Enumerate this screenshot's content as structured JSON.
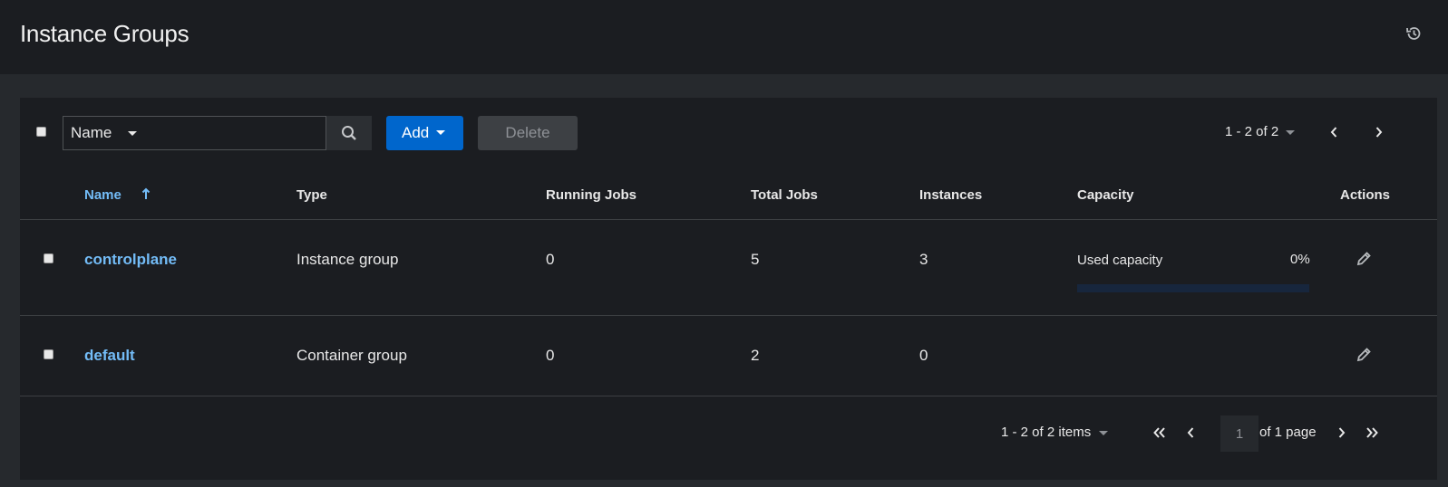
{
  "header": {
    "title": "Instance Groups"
  },
  "toolbar": {
    "filter_label": "Name",
    "search_placeholder": "",
    "add_label": "Add",
    "delete_label": "Delete",
    "pagination": "1 - 2 of 2"
  },
  "table": {
    "columns": [
      "Name",
      "Type",
      "Running Jobs",
      "Total Jobs",
      "Instances",
      "Capacity",
      "Actions"
    ],
    "rows": [
      {
        "name": "controlplane",
        "type": "Instance group",
        "running_jobs": "0",
        "total_jobs": "5",
        "instances": "3",
        "capacity_label": "Used capacity",
        "capacity_value": "0%",
        "capacity_fraction": 0
      },
      {
        "name": "default",
        "type": "Container group",
        "running_jobs": "0",
        "total_jobs": "2",
        "instances": "0",
        "capacity_label": "",
        "capacity_value": ""
      }
    ]
  },
  "footer": {
    "items": "1 - 2 of 2 items",
    "page_value": "1",
    "of_pages": "of 1 page"
  },
  "colors": {
    "accent": "#0066cc",
    "link": "#73bcf7",
    "background": "#1b1d21"
  },
  "icons": [
    "history-icon",
    "search-icon",
    "caret-down-icon",
    "chevron-left-icon",
    "chevron-right-icon",
    "double-chevron-left-icon",
    "double-chevron-right-icon",
    "sort-arrow-up-icon",
    "pencil-icon"
  ]
}
